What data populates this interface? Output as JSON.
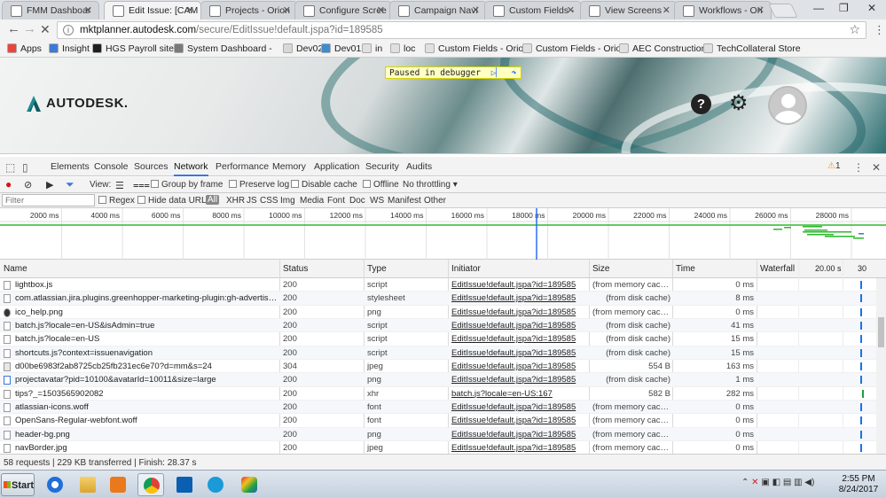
{
  "browser": {
    "tabs": [
      {
        "label": "FMM Dashboar",
        "active": false
      },
      {
        "label": "Edit Issue: [CAM",
        "active": true
      },
      {
        "label": "Projects - Orion",
        "active": false
      },
      {
        "label": "Configure Scree",
        "active": false
      },
      {
        "label": "Campaign Navi",
        "active": false
      },
      {
        "label": "Custom Fields -",
        "active": false
      },
      {
        "label": "View Screens -",
        "active": false
      },
      {
        "label": "Workflows - Ori",
        "active": false
      }
    ],
    "url_host": "mktplanner.autodesk.com",
    "url_path": "/secure/EditIssue!default.jspa?id=189585",
    "bookmarks": [
      "Apps",
      "Insight",
      "HGS Payroll site",
      "System Dashboard -",
      "Dev02",
      "Dev01",
      "in",
      "loc",
      "Custom Fields - Orio",
      "Custom Fields - Orio",
      "AEC Construction",
      "TechCollateral Store"
    ]
  },
  "page": {
    "brand": "AUTODESK.",
    "debugger_text": "Paused in debugger"
  },
  "devtools": {
    "tabs": [
      "Elements",
      "Console",
      "Sources",
      "Network",
      "Performance",
      "Memory",
      "Application",
      "Security",
      "Audits"
    ],
    "active_tab": "Network",
    "warnings": "1",
    "toolbar": {
      "view": "View:",
      "group_by_frame": "Group by frame",
      "preserve_log": "Preserve log",
      "disable_cache": "Disable cache",
      "offline": "Offline",
      "throttling": "No throttling"
    },
    "filter": {
      "placeholder": "Filter",
      "regex": "Regex",
      "hide_data_urls": "Hide data URLs",
      "types": [
        "All",
        "XHR",
        "JS",
        "CSS",
        "Img",
        "Media",
        "Font",
        "Doc",
        "WS",
        "Manifest",
        "Other"
      ]
    },
    "overview_ticks": [
      "2000 ms",
      "4000 ms",
      "6000 ms",
      "8000 ms",
      "10000 ms",
      "12000 ms",
      "14000 ms",
      "16000 ms",
      "18000 ms",
      "20000 ms",
      "22000 ms",
      "24000 ms",
      "26000 ms",
      "28000 ms"
    ],
    "columns": {
      "name": "Name",
      "status": "Status",
      "type": "Type",
      "initiator": "Initiator",
      "size": "Size",
      "time": "Time",
      "waterfall": "Waterfall",
      "wf_tick1": "20.00 s",
      "wf_tick2": "30"
    },
    "requests": [
      {
        "name": "lightbox.js",
        "status": "200",
        "type": "script",
        "initiator": "EditIssue!default.jspa?id=189585",
        "size": "(from memory cache)",
        "time": "0 ms",
        "icon": "file"
      },
      {
        "name": "com.atlassian.jira.plugins.greenhopper-marketing-plugin:gh-advertising-re...",
        "status": "200",
        "type": "stylesheet",
        "initiator": "EditIssue!default.jspa?id=189585",
        "size": "(from disk cache)",
        "time": "8 ms",
        "icon": "file"
      },
      {
        "name": "ico_help.png",
        "status": "200",
        "type": "png",
        "initiator": "EditIssue!default.jspa?id=189585",
        "size": "(from memory cache)",
        "time": "0 ms",
        "icon": "help"
      },
      {
        "name": "batch.js?locale=en-US&isAdmin=true",
        "status": "200",
        "type": "script",
        "initiator": "EditIssue!default.jspa?id=189585",
        "size": "(from disk cache)",
        "time": "41 ms",
        "icon": "file"
      },
      {
        "name": "batch.js?locale=en-US",
        "status": "200",
        "type": "script",
        "initiator": "EditIssue!default.jspa?id=189585",
        "size": "(from disk cache)",
        "time": "15 ms",
        "icon": "file"
      },
      {
        "name": "shortcuts.js?context=issuenavigation",
        "status": "200",
        "type": "script",
        "initiator": "EditIssue!default.jspa?id=189585",
        "size": "(from disk cache)",
        "time": "15 ms",
        "icon": "file"
      },
      {
        "name": "d00be6983f2ab8725cb25fb231ec6e70?d=mm&s=24",
        "status": "304",
        "type": "jpeg",
        "initiator": "EditIssue!default.jspa?id=189585",
        "size": "554 B",
        "time": "163 ms",
        "icon": "image"
      },
      {
        "name": "projectavatar?pid=10100&avatarId=10011&size=large",
        "status": "200",
        "type": "png",
        "initiator": "EditIssue!default.jspa?id=189585",
        "size": "(from disk cache)",
        "time": "1 ms",
        "icon": "check"
      },
      {
        "name": "tips?_=1503565902082",
        "status": "200",
        "type": "xhr",
        "initiator": "batch.js?locale=en-US:167",
        "size": "582 B",
        "time": "282 ms",
        "icon": "file"
      },
      {
        "name": "atlassian-icons.woff",
        "status": "200",
        "type": "font",
        "initiator": "EditIssue!default.jspa?id=189585",
        "size": "(from memory cache)",
        "time": "0 ms",
        "icon": "file"
      },
      {
        "name": "OpenSans-Regular-webfont.woff",
        "status": "200",
        "type": "font",
        "initiator": "EditIssue!default.jspa?id=189585",
        "size": "(from memory cache)",
        "time": "0 ms",
        "icon": "file"
      },
      {
        "name": "header-bg.png",
        "status": "200",
        "type": "png",
        "initiator": "EditIssue!default.jspa?id=189585",
        "size": "(from memory cache)",
        "time": "0 ms",
        "icon": "file"
      },
      {
        "name": "navBorder.jpg",
        "status": "200",
        "type": "jpeg",
        "initiator": "EditIssue!default.jspa?id=189585",
        "size": "(from memory cache)",
        "time": "0 ms",
        "icon": "file"
      }
    ],
    "status_bar": "58 requests  |  229 KB transferred  |  Finish: 28.37 s"
  },
  "taskbar": {
    "start": "Start",
    "time": "2:55 PM",
    "date": "8/24/2017"
  }
}
